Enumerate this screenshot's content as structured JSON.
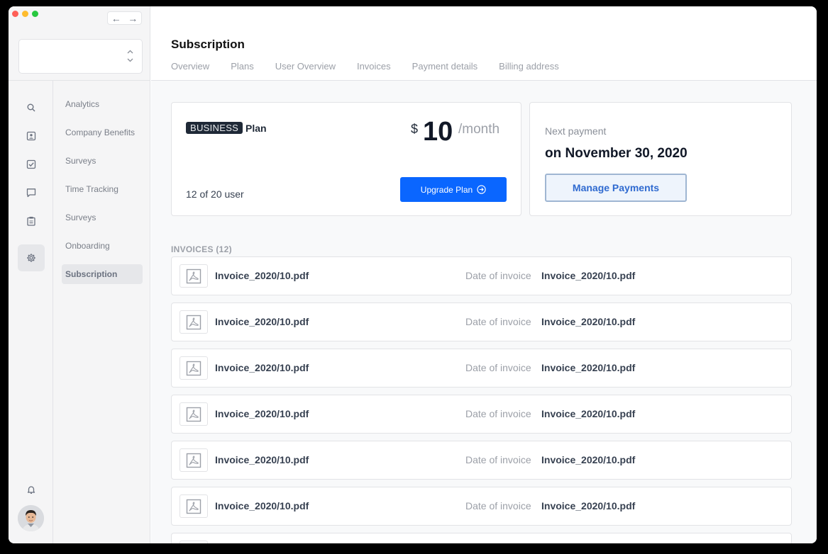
{
  "window": {
    "traffic_lights": [
      "#fe5f57",
      "#febc2e",
      "#28c840"
    ]
  },
  "navigation": {
    "back_icon": "arrow-left-icon",
    "forward_icon": "arrow-right-icon",
    "back": "←",
    "forward": "→"
  },
  "workspace_selector": {
    "value": "",
    "icon": "chevron-up-down-icon"
  },
  "icon_rail": {
    "items": [
      {
        "icon": "search-icon"
      },
      {
        "icon": "contact-card-icon"
      },
      {
        "icon": "checkbox-icon"
      },
      {
        "icon": "chat-icon"
      },
      {
        "icon": "clipboard-icon"
      },
      {
        "icon": "gear-icon",
        "active": true
      }
    ],
    "bottom": [
      {
        "icon": "bell-icon"
      },
      {
        "icon": "avatar"
      }
    ]
  },
  "subnav": {
    "items": [
      {
        "label": "Analytics"
      },
      {
        "label": "Company Benefits"
      },
      {
        "label": "Surveys"
      },
      {
        "label": "Time Tracking"
      },
      {
        "label": "Surveys"
      },
      {
        "label": "Onboarding"
      },
      {
        "label": "Subscription",
        "active": true
      }
    ]
  },
  "header": {
    "title": "Subscription",
    "tabs": [
      {
        "label": "Overview"
      },
      {
        "label": "Plans"
      },
      {
        "label": "User Overview"
      },
      {
        "label": "Invoices"
      },
      {
        "label": "Payment details"
      },
      {
        "label": "Billing address"
      }
    ]
  },
  "plan": {
    "badge": "BUSINESS",
    "word": "Plan",
    "currency": "$",
    "amount": "10",
    "period": "/month",
    "users": "12 of 20 user",
    "upgrade_label": "Upgrade Plan",
    "upgrade_icon": "arrow-circle-right-icon",
    "accent": "#0a66ff"
  },
  "payment": {
    "label": "Next payment",
    "date": "on November 30, 2020",
    "manage_label": "Manage Payments"
  },
  "invoices": {
    "title": "INVOICES (12)",
    "date_label": "Date of invoice",
    "rows": [
      {
        "name": "Invoice_2020/10.pdf",
        "date": "Invoice_2020/10.pdf"
      },
      {
        "name": "Invoice_2020/10.pdf",
        "date": "Invoice_2020/10.pdf"
      },
      {
        "name": "Invoice_2020/10.pdf",
        "date": "Invoice_2020/10.pdf"
      },
      {
        "name": "Invoice_2020/10.pdf",
        "date": "Invoice_2020/10.pdf"
      },
      {
        "name": "Invoice_2020/10.pdf",
        "date": "Invoice_2020/10.pdf"
      },
      {
        "name": "Invoice_2020/10.pdf",
        "date": "Invoice_2020/10.pdf"
      },
      {
        "name": "",
        "date": ""
      }
    ],
    "row_icon": "pdf-file-icon"
  }
}
